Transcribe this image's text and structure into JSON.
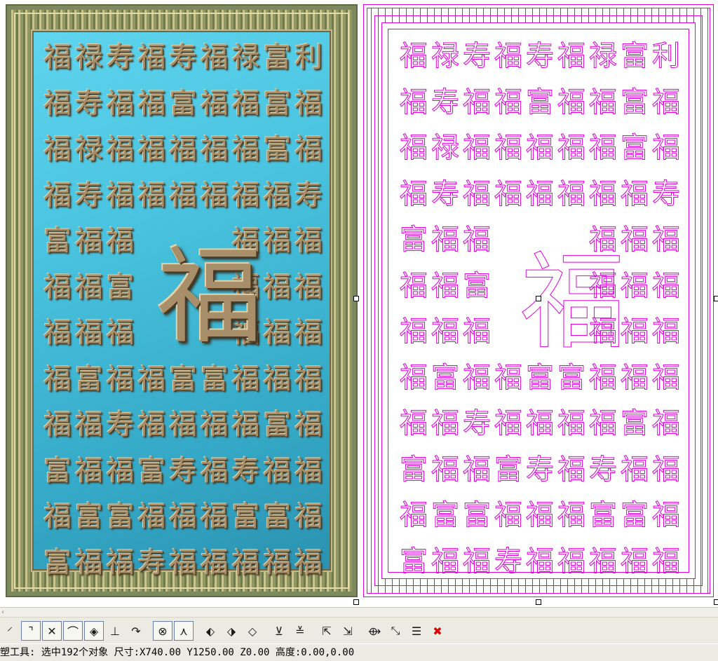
{
  "panels": {
    "relief_label": "relief-render",
    "vector_label": "vector-outline"
  },
  "characters": {
    "rows": [
      [
        "福",
        "禄",
        "寿",
        "福",
        "寿",
        "福",
        "禄",
        "富",
        "利"
      ],
      [
        "福",
        "寿",
        "福",
        "福",
        "富",
        "福",
        "福",
        "富",
        "福"
      ],
      [
        "福",
        "禄",
        "福",
        "福",
        "福",
        "福",
        "福",
        "富",
        "福"
      ],
      [
        "福",
        "寿",
        "福",
        "福",
        "福",
        "福",
        "福",
        "福",
        "寿"
      ],
      [
        "富",
        "福",
        "福",
        "",
        "",
        "",
        "福",
        "福",
        "福"
      ],
      [
        "福",
        "福",
        "富",
        "",
        "",
        "",
        "福",
        "福",
        "福"
      ],
      [
        "福",
        "福",
        "福",
        "",
        "",
        "",
        "福",
        "福",
        "福"
      ],
      [
        "福",
        "富",
        "福",
        "福",
        "富",
        "富",
        "福",
        "福",
        "福"
      ],
      [
        "福",
        "福",
        "寿",
        "福",
        "福",
        "福",
        "福",
        "富",
        "福"
      ],
      [
        "富",
        "福",
        "福",
        "富",
        "寿",
        "福",
        "寿",
        "福",
        "福"
      ],
      [
        "福",
        "富",
        "富",
        "福",
        "福",
        "福",
        "富",
        "富",
        "福"
      ],
      [
        "富",
        "福",
        "福",
        "寿",
        "福",
        "福",
        "福",
        "福",
        "福"
      ]
    ],
    "center": "福"
  },
  "toolbar": {
    "buttons": [
      {
        "icon": "polyline-icon",
        "glyph": "⸍",
        "boxed": false
      },
      {
        "icon": "corner-curve-icon",
        "glyph": "⌝",
        "boxed": true
      },
      {
        "icon": "trim-cross-icon",
        "glyph": "✕",
        "boxed": true
      },
      {
        "icon": "fillet-icon",
        "glyph": "⌒",
        "boxed": true
      },
      {
        "icon": "circle-node-icon",
        "glyph": "◈",
        "boxed": true
      },
      {
        "icon": "perpendicular-icon",
        "glyph": "⊥",
        "boxed": false
      },
      {
        "icon": "arc-tangent-icon",
        "glyph": "↷",
        "boxed": false
      },
      {
        "icon": "center-point-icon",
        "glyph": "⊗",
        "boxed": true
      },
      {
        "icon": "vertex-icon",
        "glyph": "⋏",
        "boxed": true
      },
      {
        "icon": "diamond-left-icon",
        "glyph": "⬖",
        "boxed": false
      },
      {
        "icon": "diamond-center-icon",
        "glyph": "⬗",
        "boxed": false
      },
      {
        "icon": "diamond-right-icon",
        "glyph": "◇",
        "boxed": false
      },
      {
        "icon": "layer-base-icon",
        "glyph": "⊻",
        "boxed": false
      },
      {
        "icon": "layer-stack-icon",
        "glyph": "≚",
        "boxed": false
      },
      {
        "icon": "select-add-icon",
        "glyph": "⇱",
        "boxed": false
      },
      {
        "icon": "select-remove-icon",
        "glyph": "⇲",
        "boxed": false
      },
      {
        "icon": "transform-icon",
        "glyph": "⟴",
        "boxed": false
      },
      {
        "icon": "measure-icon",
        "glyph": "⤡",
        "boxed": false
      },
      {
        "icon": "list-select-icon",
        "glyph": "☰",
        "boxed": false
      },
      {
        "icon": "delete-icon",
        "glyph": "✖",
        "boxed": false,
        "color": "#dd0000"
      }
    ]
  },
  "status": {
    "text": "塑工具: 选中192个对象 尺寸:X740.00 Y1250.00 Z0.00 高度:0.00,0.00"
  },
  "colors": {
    "vector_stroke": "#e000e0",
    "relief_field": "#49c3df",
    "relief_char": "#a88f6a"
  }
}
